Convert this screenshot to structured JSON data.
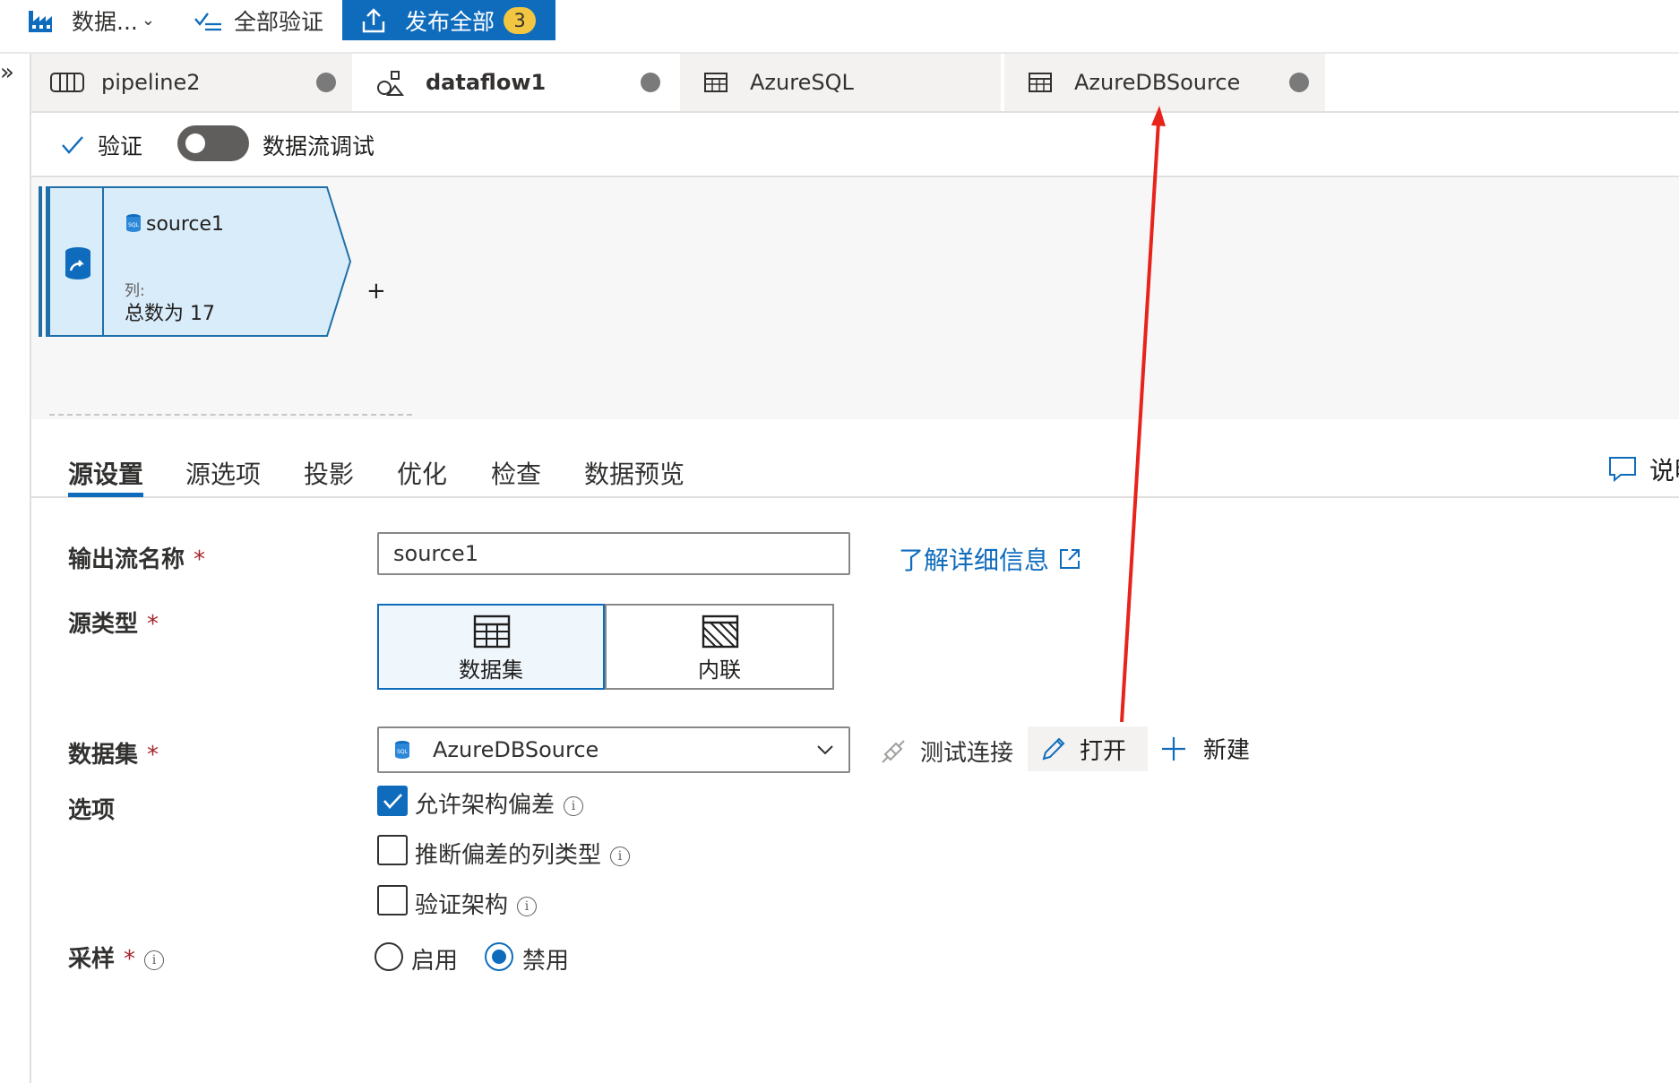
{
  "toolbar": {
    "data_factory_label": "数据...",
    "validate_all_label": "全部验证",
    "publish_all_label": "发布全部",
    "publish_count": "3"
  },
  "tabs": [
    {
      "label": "pipeline2",
      "icon": "pipeline-icon",
      "unsaved": true,
      "active": false
    },
    {
      "label": "dataflow1",
      "icon": "dataflow-icon",
      "unsaved": true,
      "active": true
    },
    {
      "label": "AzureSQL",
      "icon": "table-icon",
      "unsaved": false,
      "active": false
    },
    {
      "label": "AzureDBSource",
      "icon": "table-icon",
      "unsaved": true,
      "active": false
    }
  ],
  "commands": {
    "validate_label": "验证",
    "debug_label": "数据流调试",
    "debug_on": false
  },
  "canvas": {
    "node_name": "source1",
    "columns_label": "列:",
    "columns_total": "总数为 17",
    "add_symbol": "+"
  },
  "panel": {
    "tabs": [
      "源设置",
      "源选项",
      "投影",
      "优化",
      "检查",
      "数据预览"
    ],
    "active_tab": "源设置",
    "description_label": "说明",
    "output_stream_label": "输出流名称",
    "output_stream_value": "source1",
    "learn_more_label": "了解详细信息",
    "source_type_label": "源类型",
    "source_type_options": [
      "数据集",
      "内联"
    ],
    "source_type_selected": "数据集",
    "dataset_label": "数据集",
    "dataset_value": "AzureDBSource",
    "test_connection_label": "测试连接",
    "open_label": "打开",
    "new_label": "新建",
    "options_label": "选项",
    "options": [
      {
        "label": "允许架构偏差",
        "checked": true
      },
      {
        "label": "推断偏差的列类型",
        "checked": false
      },
      {
        "label": "验证架构",
        "checked": false
      }
    ],
    "sampling_label": "采样",
    "sampling_options": [
      "启用",
      "禁用"
    ],
    "sampling_selected": "禁用",
    "required_mark": "*"
  },
  "colors": {
    "accent": "#0f6cbd",
    "node_fill": "#d9ecfa",
    "node_border": "#1f6fa8",
    "arrow": "#e8231c",
    "badge": "#f3c641"
  }
}
